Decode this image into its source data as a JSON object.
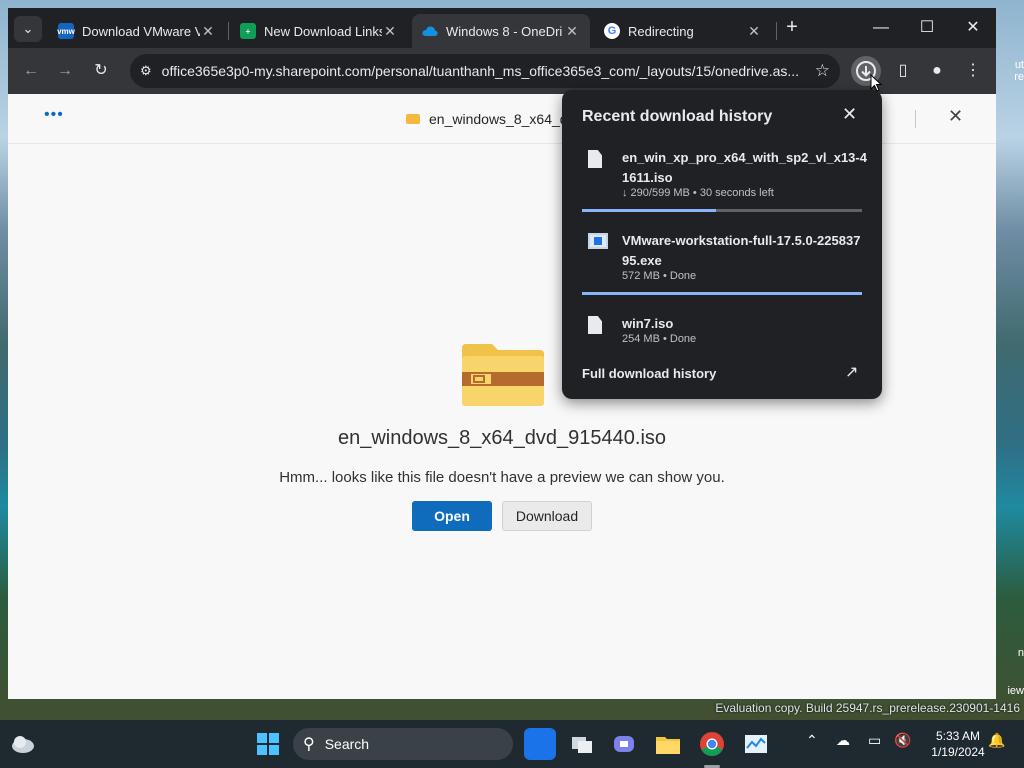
{
  "browser": {
    "tabs": [
      {
        "title": "Download VMware V",
        "favicon": "vmware-icon",
        "color": "#1565c0",
        "fav_text": "vmw"
      },
      {
        "title": "New Download Links",
        "favicon": "sheets-icon",
        "color": "#0f9d58",
        "fav_text": "+"
      },
      {
        "title": "Windows 8 - OneDri",
        "favicon": "onedrive-icon",
        "color": "#0f6cbd",
        "fav_text": ""
      },
      {
        "title": "Redirecting",
        "favicon": "google-icon",
        "color": "#ffffff",
        "fav_text": "G"
      }
    ],
    "url": "office365e3p0-my.sharepoint.com/personal/tuanthanh_ms_office365e3_com/_layouts/15/onedrive.as..."
  },
  "page": {
    "header_filename": "en_windows_8_x64_dv",
    "file_name": "en_windows_8_x64_dvd_915440.iso",
    "message": "Hmm... looks like this file doesn't have a preview we can show you.",
    "open_label": "Open",
    "download_label": "Download"
  },
  "downloads": {
    "title": "Recent download history",
    "items": [
      {
        "name": "en_win_xp_pro_x64_with_sp2_vl_x13-41611.iso",
        "status": "↓ 290/599 MB • 30 seconds left",
        "progress": 0.48,
        "icon": "file-icon"
      },
      {
        "name": "VMware-workstation-full-17.5.0-22583795.exe",
        "status": "572 MB • Done",
        "progress": 1.0,
        "icon": "exe-icon"
      },
      {
        "name": "win7.iso",
        "status": "254 MB • Done",
        "progress": null,
        "icon": "file-icon"
      }
    ],
    "full_history": "Full download history"
  },
  "desktop": {
    "eval_text": "Evaluation copy. Build 25947.rs_prerelease.230901-1416",
    "right_snippets": [
      "ut",
      "re",
      "n",
      "iew"
    ]
  },
  "taskbar": {
    "search_label": "Search",
    "time": "5:33 AM",
    "date": "1/19/2024"
  }
}
